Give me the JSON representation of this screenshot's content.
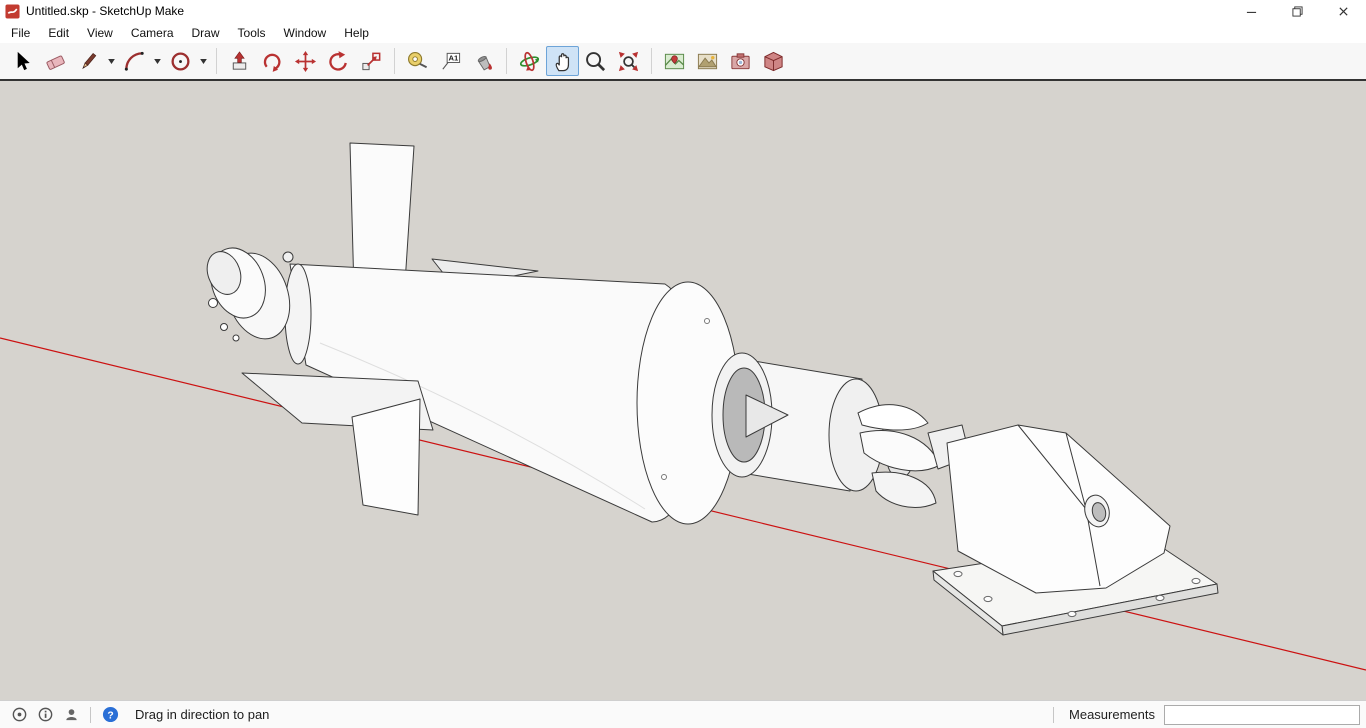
{
  "window": {
    "title": "Untitled.skp - SketchUp Make"
  },
  "menu_bar": {
    "items": [
      "File",
      "Edit",
      "View",
      "Camera",
      "Draw",
      "Tools",
      "Window",
      "Help"
    ]
  },
  "toolbar": {
    "selected_tool": "pan",
    "text_tool_glyph": "A1",
    "tool_icons": [
      "select-icon",
      "eraser-icon",
      "line-icon",
      "arc-icon",
      "circle-icon",
      "push-pull-icon",
      "follow-me-icon",
      "move-icon",
      "rotate-icon",
      "scale-icon",
      "tape-measure-icon",
      "text-icon",
      "paint-bucket-icon",
      "orbit-icon",
      "pan-icon",
      "zoom-icon",
      "zoom-extents-icon",
      "add-location-icon",
      "toggle-terrain-icon",
      "photo-textures-icon",
      "extension-warehouse-icon"
    ]
  },
  "viewport": {
    "background_color": "#d6d3ce",
    "axis_color": "#cc1111",
    "model": "white turbine assembly with tail fins, impeller and mounting plate"
  },
  "status_bar": {
    "hint": "Drag in direction to pan",
    "measurements_label": "Measurements",
    "measurements_value": ""
  }
}
